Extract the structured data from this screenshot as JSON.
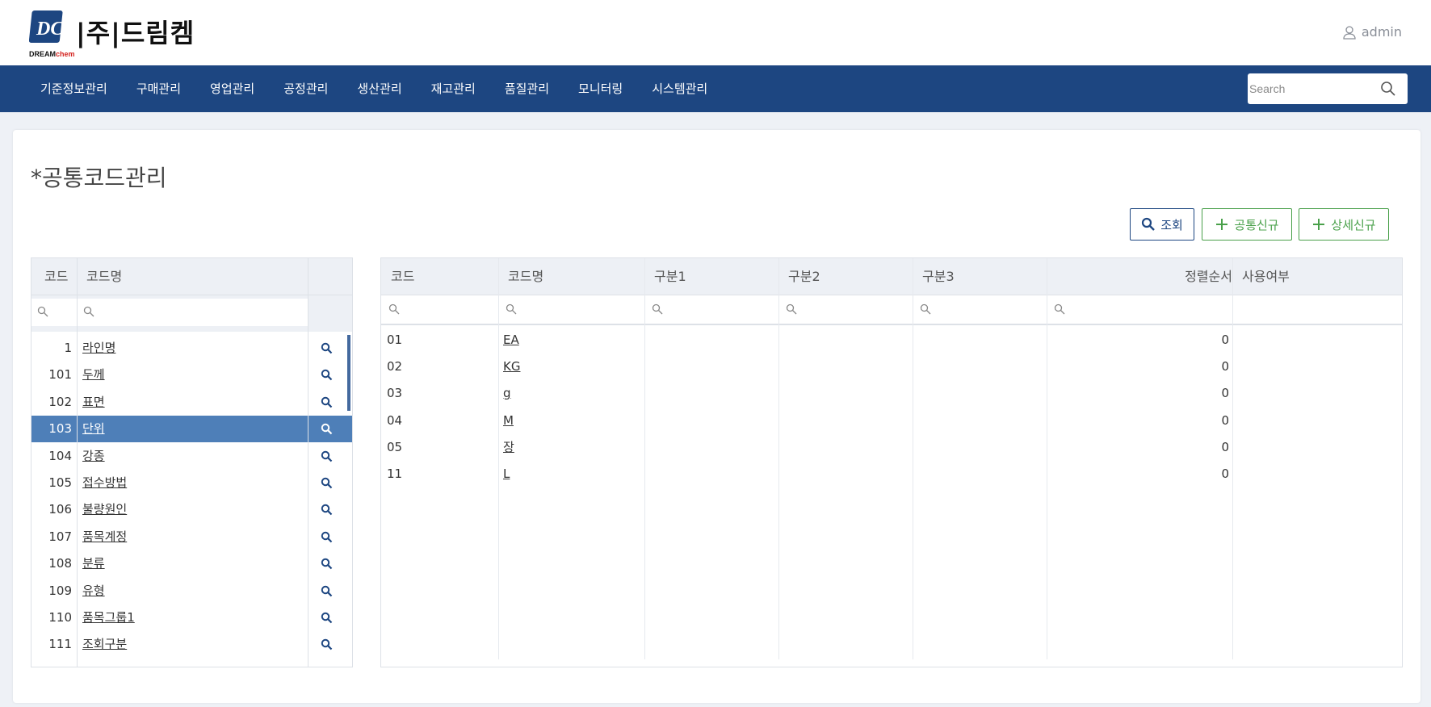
{
  "brand": {
    "logo_text": "|주|드림켐",
    "logo_sub_a": "DREAM",
    "logo_sub_b": "chem",
    "brand_color": "#1d4681"
  },
  "user": {
    "name": "admin",
    "icon": "user-icon"
  },
  "nav": {
    "items": [
      "기준정보관리",
      "구매관리",
      "영업관리",
      "공정관리",
      "생산관리",
      "재고관리",
      "품질관리",
      "모니터링",
      "시스템관리"
    ],
    "search_placeholder": "Search"
  },
  "page": {
    "title": "*공통코드관리",
    "buttons": {
      "search": "조회",
      "common_new": "공통신규",
      "detail_new": "상세신규"
    }
  },
  "left_grid": {
    "headers": {
      "code": "코드",
      "name": "코드명"
    },
    "rows": [
      {
        "code": "1",
        "name": "라인명"
      },
      {
        "code": "101",
        "name": "두께"
      },
      {
        "code": "102",
        "name": "표면"
      },
      {
        "code": "103",
        "name": "단위",
        "selected": true
      },
      {
        "code": "104",
        "name": "강종"
      },
      {
        "code": "105",
        "name": "접수방법"
      },
      {
        "code": "106",
        "name": "불량원인"
      },
      {
        "code": "107",
        "name": "품목계정"
      },
      {
        "code": "108",
        "name": "분류"
      },
      {
        "code": "109",
        "name": "유형"
      },
      {
        "code": "110",
        "name": "품목그룹1"
      },
      {
        "code": "111",
        "name": "조회구분"
      }
    ]
  },
  "right_grid": {
    "headers": {
      "code": "코드",
      "name": "코드명",
      "div1": "구분1",
      "div2": "구분2",
      "div3": "구분3",
      "sort": "정렬순서",
      "use": "사용여부"
    },
    "rows": [
      {
        "code": "01",
        "name": "EA",
        "sort": "0"
      },
      {
        "code": "02",
        "name": "KG",
        "sort": "0"
      },
      {
        "code": "03",
        "name": "g",
        "sort": "0"
      },
      {
        "code": "04",
        "name": "M",
        "sort": "0"
      },
      {
        "code": "05",
        "name": "장",
        "sort": "0"
      },
      {
        "code": "11",
        "name": "L",
        "sort": "0"
      }
    ]
  }
}
